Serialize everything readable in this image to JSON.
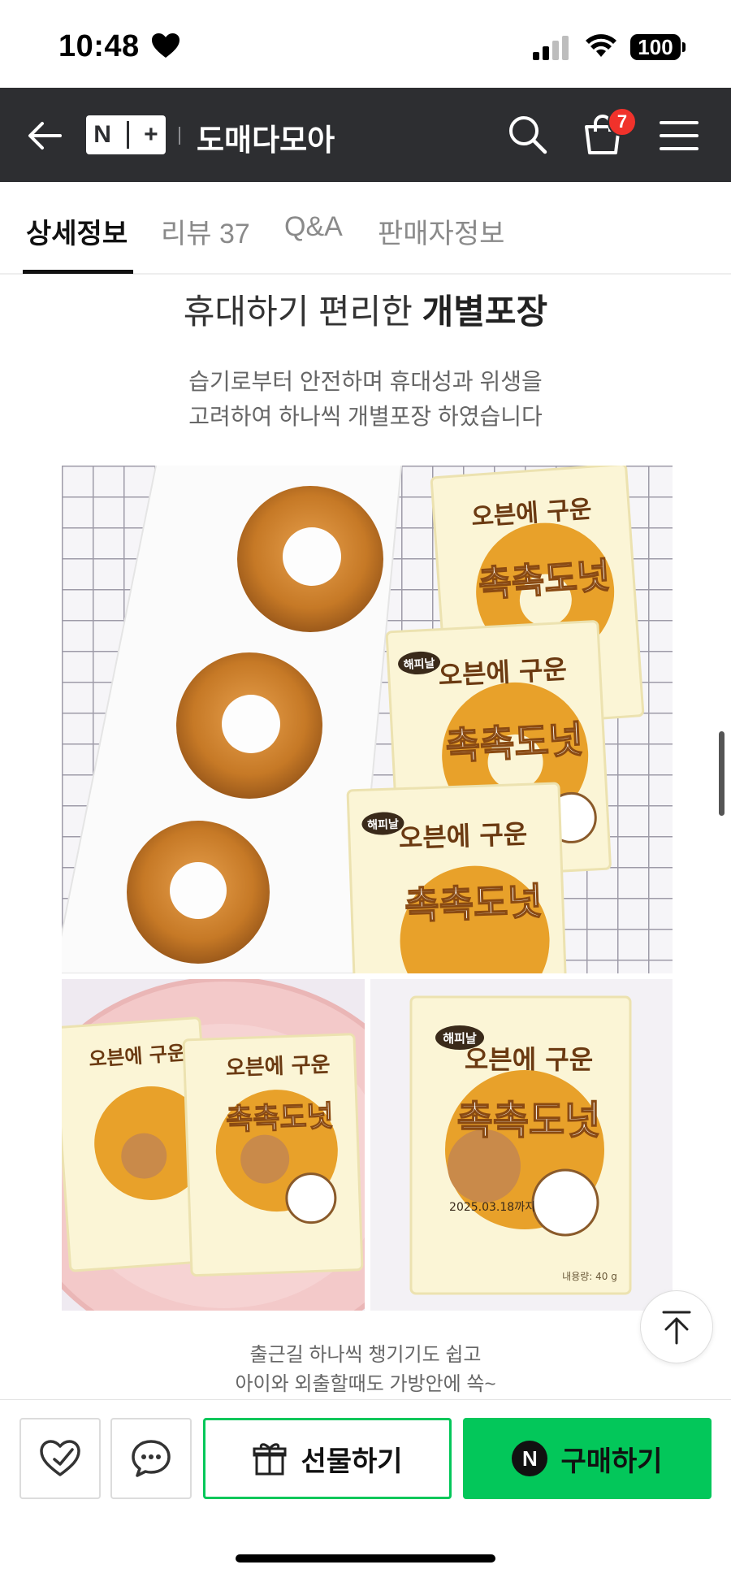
{
  "status_bar": {
    "time": "10:48",
    "battery": "100"
  },
  "header": {
    "store_name": "도매다모아",
    "cart_count": "7",
    "logo_n": "N",
    "logo_plus": "+"
  },
  "tabs": [
    {
      "label": "상세정보",
      "active": true
    },
    {
      "label": "리뷰 37",
      "active": false
    },
    {
      "label": "Q&A",
      "active": false
    },
    {
      "label": "판매자정보",
      "active": false
    }
  ],
  "content": {
    "heading_normal": "휴대하기 편리한 ",
    "heading_bold": "개별포장",
    "desc_line1": "습기로부터 안전하며 휴대성과 위생을",
    "desc_line2": "고려하여 하나씩 개별포장 하였습니다",
    "caption_line1": "출근길 하나씩 챙기기도 쉽고",
    "caption_line2": "아이와 외출할때도 가방안에 쏙~",
    "package": {
      "brand": "해피날",
      "top_text": "오븐에 구운",
      "name": "촉촉도넛",
      "date": "2025.03.18까지",
      "weight": "내용량: 40 g"
    }
  },
  "bottom_bar": {
    "gift_label": "선물하기",
    "buy_label": "구매하기",
    "buy_n": "N"
  },
  "colors": {
    "header_bg": "#2d2e31",
    "accent_green": "#03c75a",
    "badge_red": "#f0322b"
  }
}
